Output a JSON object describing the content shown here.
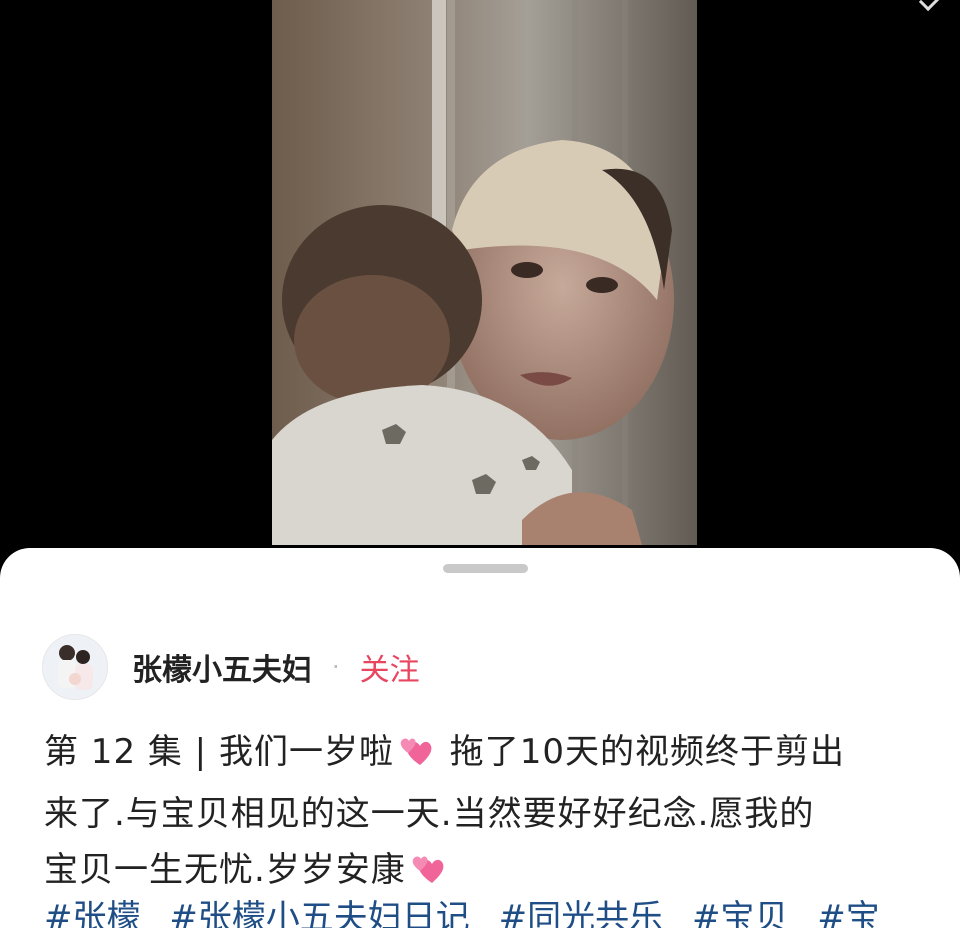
{
  "post": {
    "author": "张檬小五夫妇",
    "follow_label": "关注",
    "separator": "·",
    "line1_a": "第 12 集 | 我们一岁啦",
    "line1_b": " 拖了10天的视频终于剪出",
    "line2": "来了.与宝贝相见的这一天.当然要好好纪念.愿我的",
    "line3": "宝贝一生无忧.岁岁安康",
    "tags": [
      "#张檬",
      "#张檬小五夫妇日记",
      "#同光共乐",
      "#宝贝",
      "#宝"
    ]
  },
  "colors": {
    "accent": "#e8455f",
    "tag": "#1f4e86",
    "heart": "#f0649a"
  },
  "icons": {
    "heart": "two-hearts-icon"
  }
}
